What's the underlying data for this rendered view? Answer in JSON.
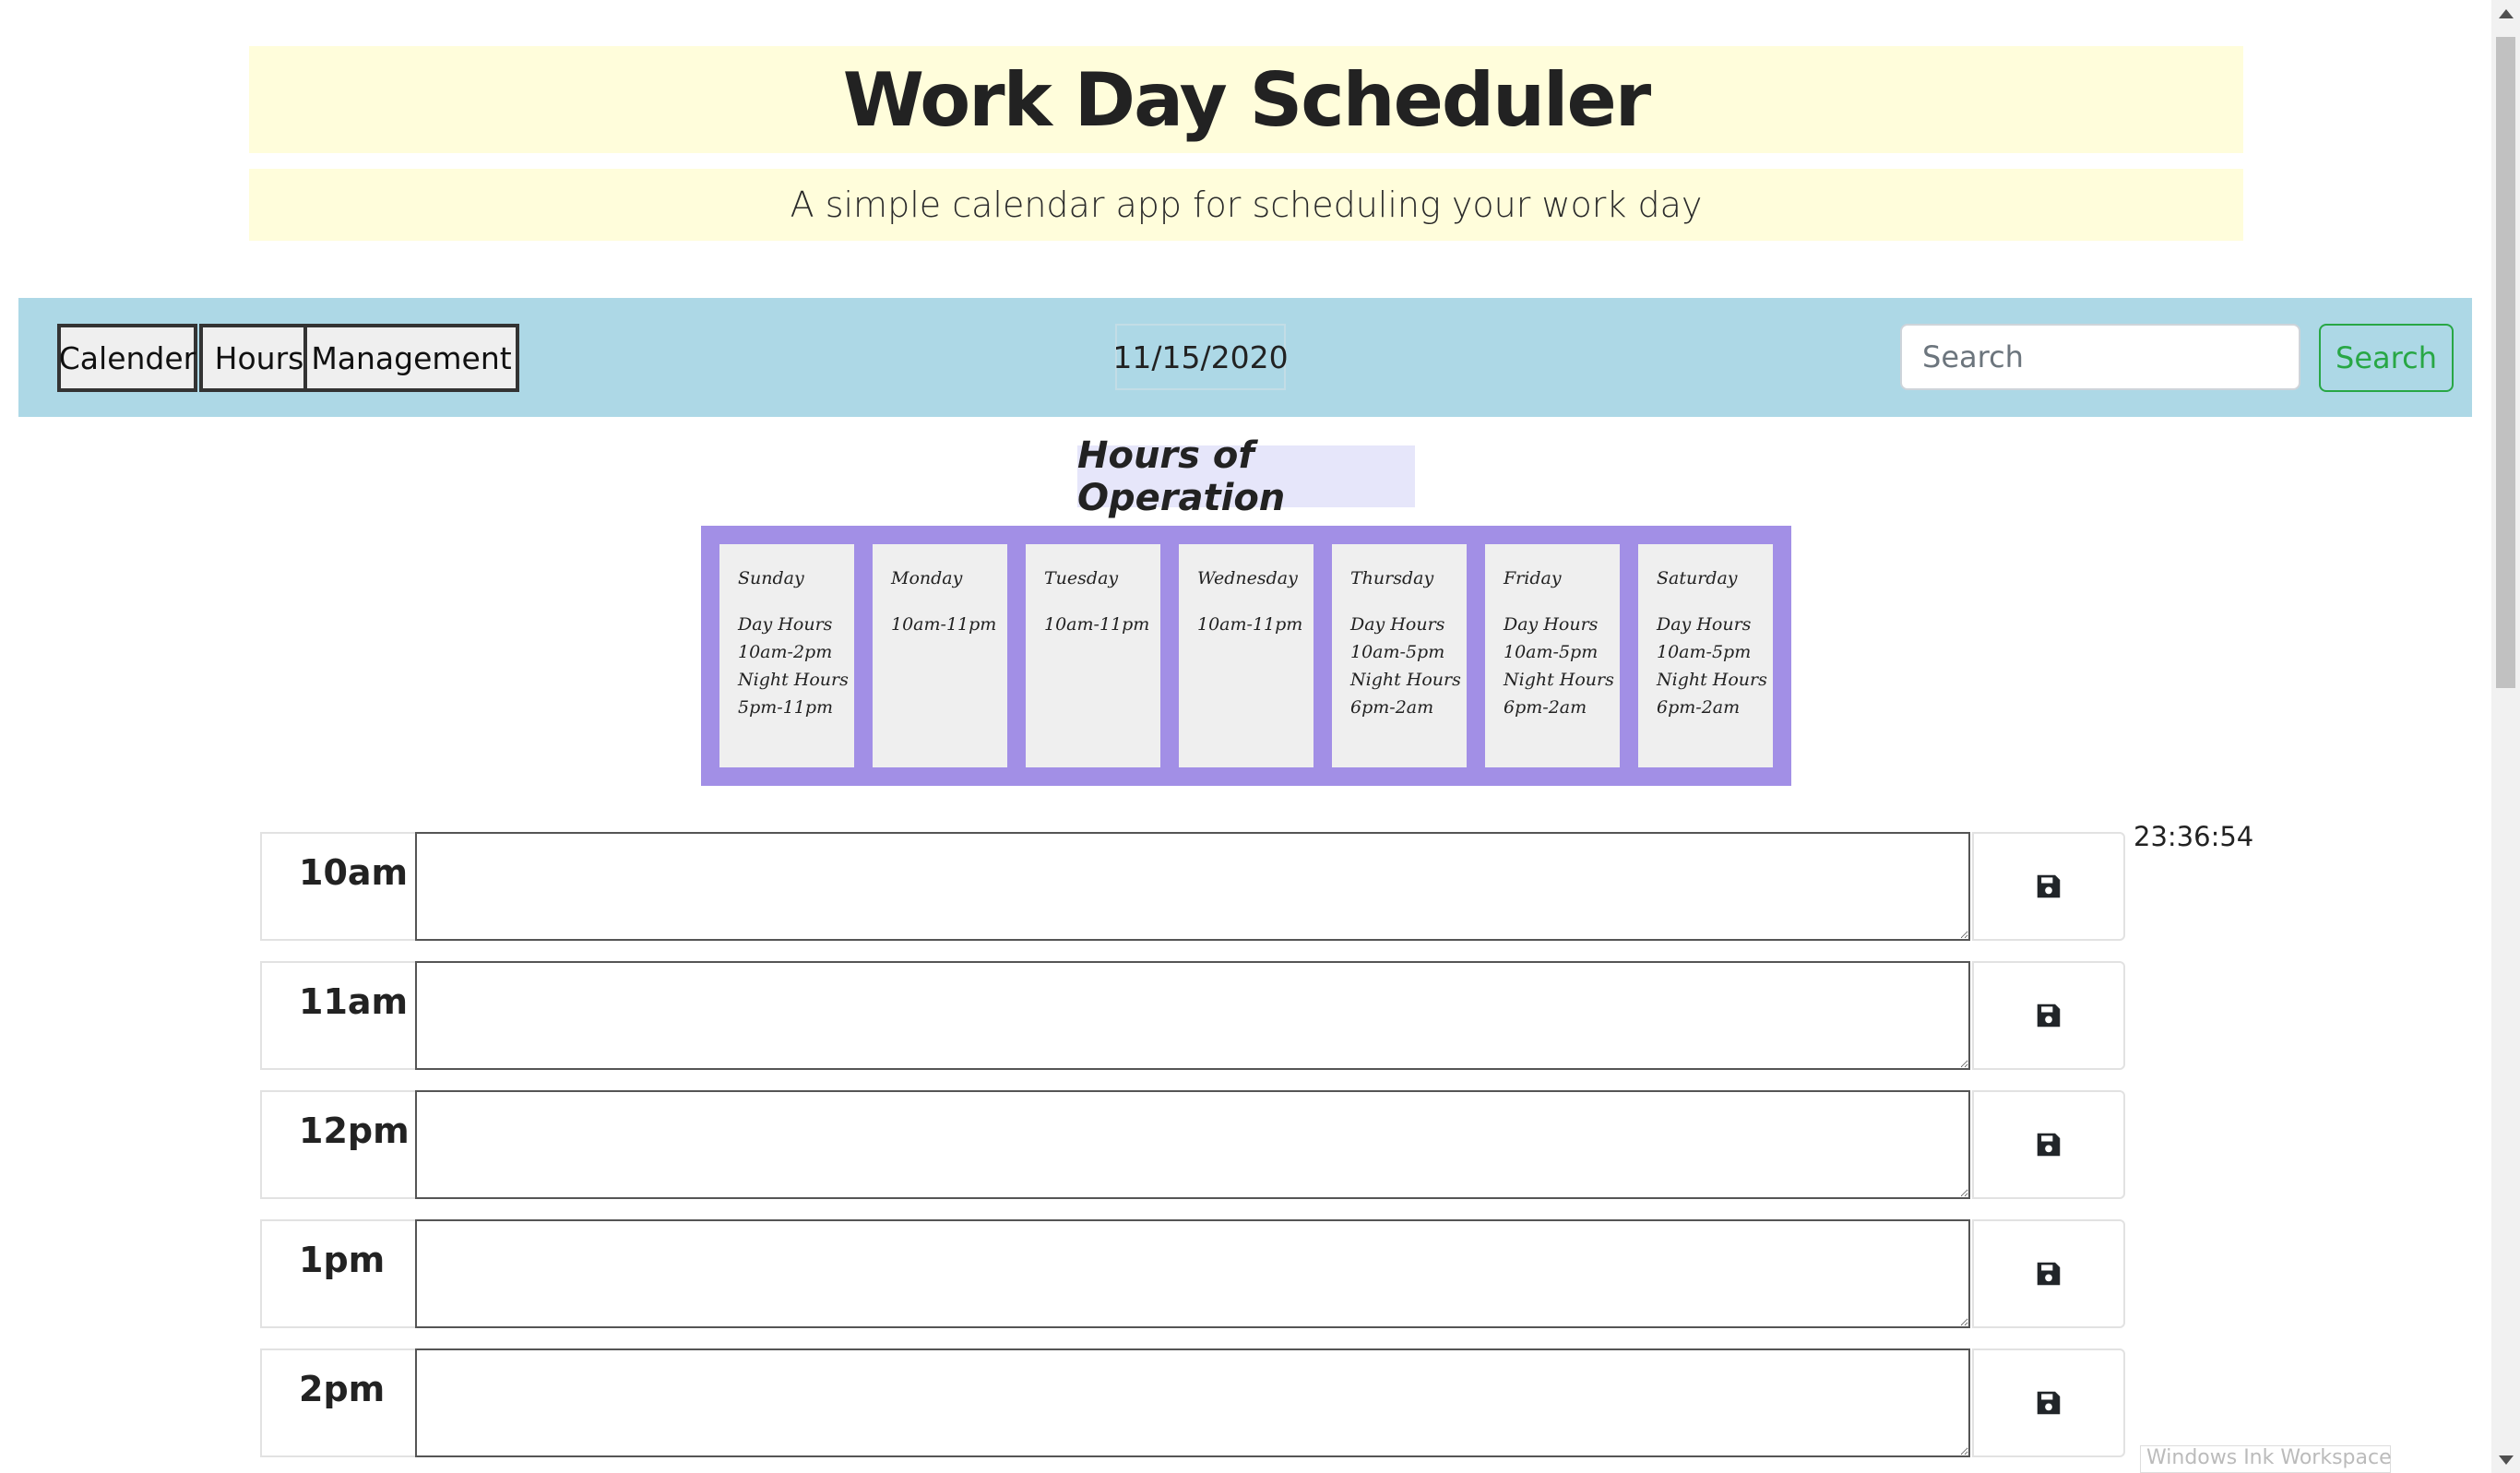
{
  "header": {
    "title": "Work Day Scheduler",
    "subtitle": "A simple calendar app for scheduling your work day"
  },
  "nav": {
    "buttons": [
      "Calender",
      "Hours",
      "Management"
    ],
    "date": "11/15/2020",
    "search_placeholder": "Search",
    "search_button": "Search"
  },
  "hours_of_operation": {
    "heading": "Hours of Operation",
    "days": [
      {
        "name": "Sunday",
        "lines": [
          "Day Hours",
          "10am-2pm",
          "Night Hours",
          "5pm-11pm"
        ]
      },
      {
        "name": "Monday",
        "lines": [
          "10am-11pm",
          "",
          "",
          ""
        ]
      },
      {
        "name": "Tuesday",
        "lines": [
          "10am-11pm",
          "",
          "",
          ""
        ]
      },
      {
        "name": "Wednesday",
        "lines": [
          "10am-11pm",
          "",
          "",
          ""
        ]
      },
      {
        "name": "Thursday",
        "lines": [
          "Day Hours",
          "10am-5pm",
          "Night Hours",
          "6pm-2am"
        ]
      },
      {
        "name": "Friday",
        "lines": [
          "Day Hours",
          "10am-5pm",
          "Night Hours",
          "6pm-2am"
        ]
      },
      {
        "name": "Saturday",
        "lines": [
          "Day Hours",
          "10am-5pm",
          "Night Hours",
          "6pm-2am"
        ]
      }
    ]
  },
  "clock": "23:36:54",
  "schedule": {
    "rows": [
      {
        "hour": "10am",
        "text": ""
      },
      {
        "hour": "11am",
        "text": ""
      },
      {
        "hour": "12pm",
        "text": ""
      },
      {
        "hour": "1pm",
        "text": ""
      },
      {
        "hour": "2pm",
        "text": ""
      }
    ],
    "save_icon": "floppy-disk-icon"
  },
  "overlay": {
    "ink_workspace": "Windows Ink Workspace"
  },
  "colors": {
    "header_bg": "#fffddb",
    "navbar_bg": "#add8e6",
    "hours_grid_bg": "#a28fe6",
    "hours_heading_bg": "#e6e6fa",
    "search_button": "#28a745"
  }
}
